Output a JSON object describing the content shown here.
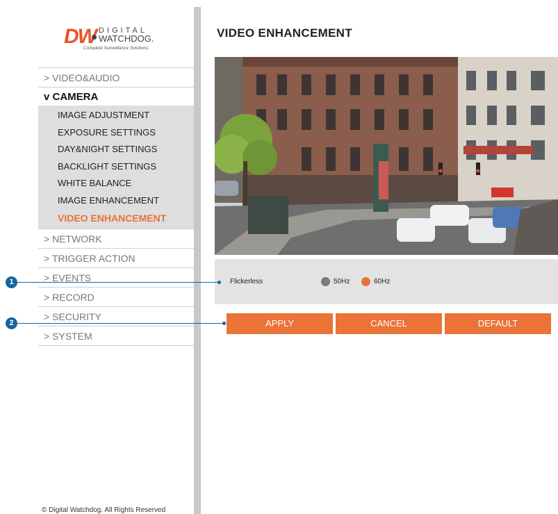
{
  "logo": {
    "mark": "DW",
    "line1": "DIGITAL",
    "line2": "WATCHDOG.",
    "tagline": "Complete Surveillance Solutions"
  },
  "nav": {
    "items_before": [
      {
        "label": "> VIDEO&AUDIO"
      }
    ],
    "open_section": {
      "label": "v CAMERA",
      "subitems": [
        {
          "label": "IMAGE ADJUSTMENT"
        },
        {
          "label": "EXPOSURE SETTINGS"
        },
        {
          "label": "DAY&NIGHT SETTINGS"
        },
        {
          "label": "BACKLIGHT SETTINGS"
        },
        {
          "label": "WHITE BALANCE"
        },
        {
          "label": "IMAGE ENHANCEMENT"
        },
        {
          "label": "VIDEO ENHANCEMENT"
        }
      ],
      "active_index": 6
    },
    "items_after": [
      {
        "label": "> NETWORK"
      },
      {
        "label": "> TRIGGER ACTION"
      },
      {
        "label": "> EVENTS"
      },
      {
        "label": "> RECORD"
      },
      {
        "label": "> SECURITY"
      },
      {
        "label": "> SYSTEM"
      }
    ]
  },
  "copyright": "© Digital Watchdog. All Rights Reserved",
  "page_title": "VIDEO ENHANCEMENT",
  "flickerless": {
    "label": "Flickerless",
    "options": [
      {
        "label": "50Hz",
        "selected": false
      },
      {
        "label": "60Hz",
        "selected": true
      }
    ]
  },
  "buttons": {
    "apply": "APPLY",
    "cancel": "CANCEL",
    "default": "DEFAULT"
  },
  "callouts": [
    "1",
    "2"
  ],
  "colors": {
    "accent": "#ea7337",
    "active_text": "#e8713a",
    "radio_unselected": "#7a7a7a",
    "callout": "#1464a0"
  }
}
